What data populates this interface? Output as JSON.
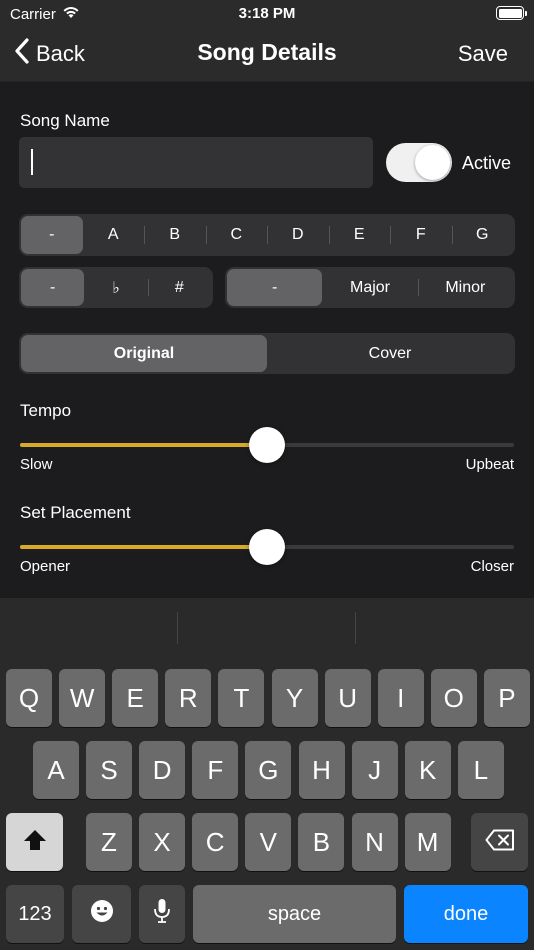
{
  "status_bar": {
    "carrier": "Carrier",
    "time": "3:18 PM"
  },
  "nav": {
    "back_label": "Back",
    "title": "Song Details",
    "save_label": "Save"
  },
  "form": {
    "song_name_label": "Song Name",
    "song_name_value": "",
    "active_label": "Active",
    "active_on": true,
    "key_note": {
      "options": [
        "-",
        "A",
        "B",
        "C",
        "D",
        "E",
        "F",
        "G"
      ],
      "selected_index": 0
    },
    "accidental": {
      "options": [
        "-",
        "♭",
        "#"
      ],
      "selected_index": 0
    },
    "mode": {
      "options": [
        "-",
        "Major",
        "Minor"
      ],
      "selected_index": 0
    },
    "version": {
      "options": [
        "Original",
        "Cover"
      ],
      "selected_index": 0
    },
    "tempo": {
      "label": "Tempo",
      "min_label": "Slow",
      "max_label": "Upbeat",
      "value": 0.5
    },
    "placement": {
      "label": "Set Placement",
      "min_label": "Opener",
      "max_label": "Closer",
      "value": 0.5
    }
  },
  "keyboard": {
    "row1": [
      "Q",
      "W",
      "E",
      "R",
      "T",
      "Y",
      "U",
      "I",
      "O",
      "P"
    ],
    "row2": [
      "A",
      "S",
      "D",
      "F",
      "G",
      "H",
      "J",
      "K",
      "L"
    ],
    "row3": [
      "Z",
      "X",
      "C",
      "V",
      "B",
      "N",
      "M"
    ],
    "numbers_label": "123",
    "space_label": "space",
    "done_label": "done"
  },
  "colors": {
    "accent": "#d9a92a",
    "done_key": "#0a84ff"
  }
}
